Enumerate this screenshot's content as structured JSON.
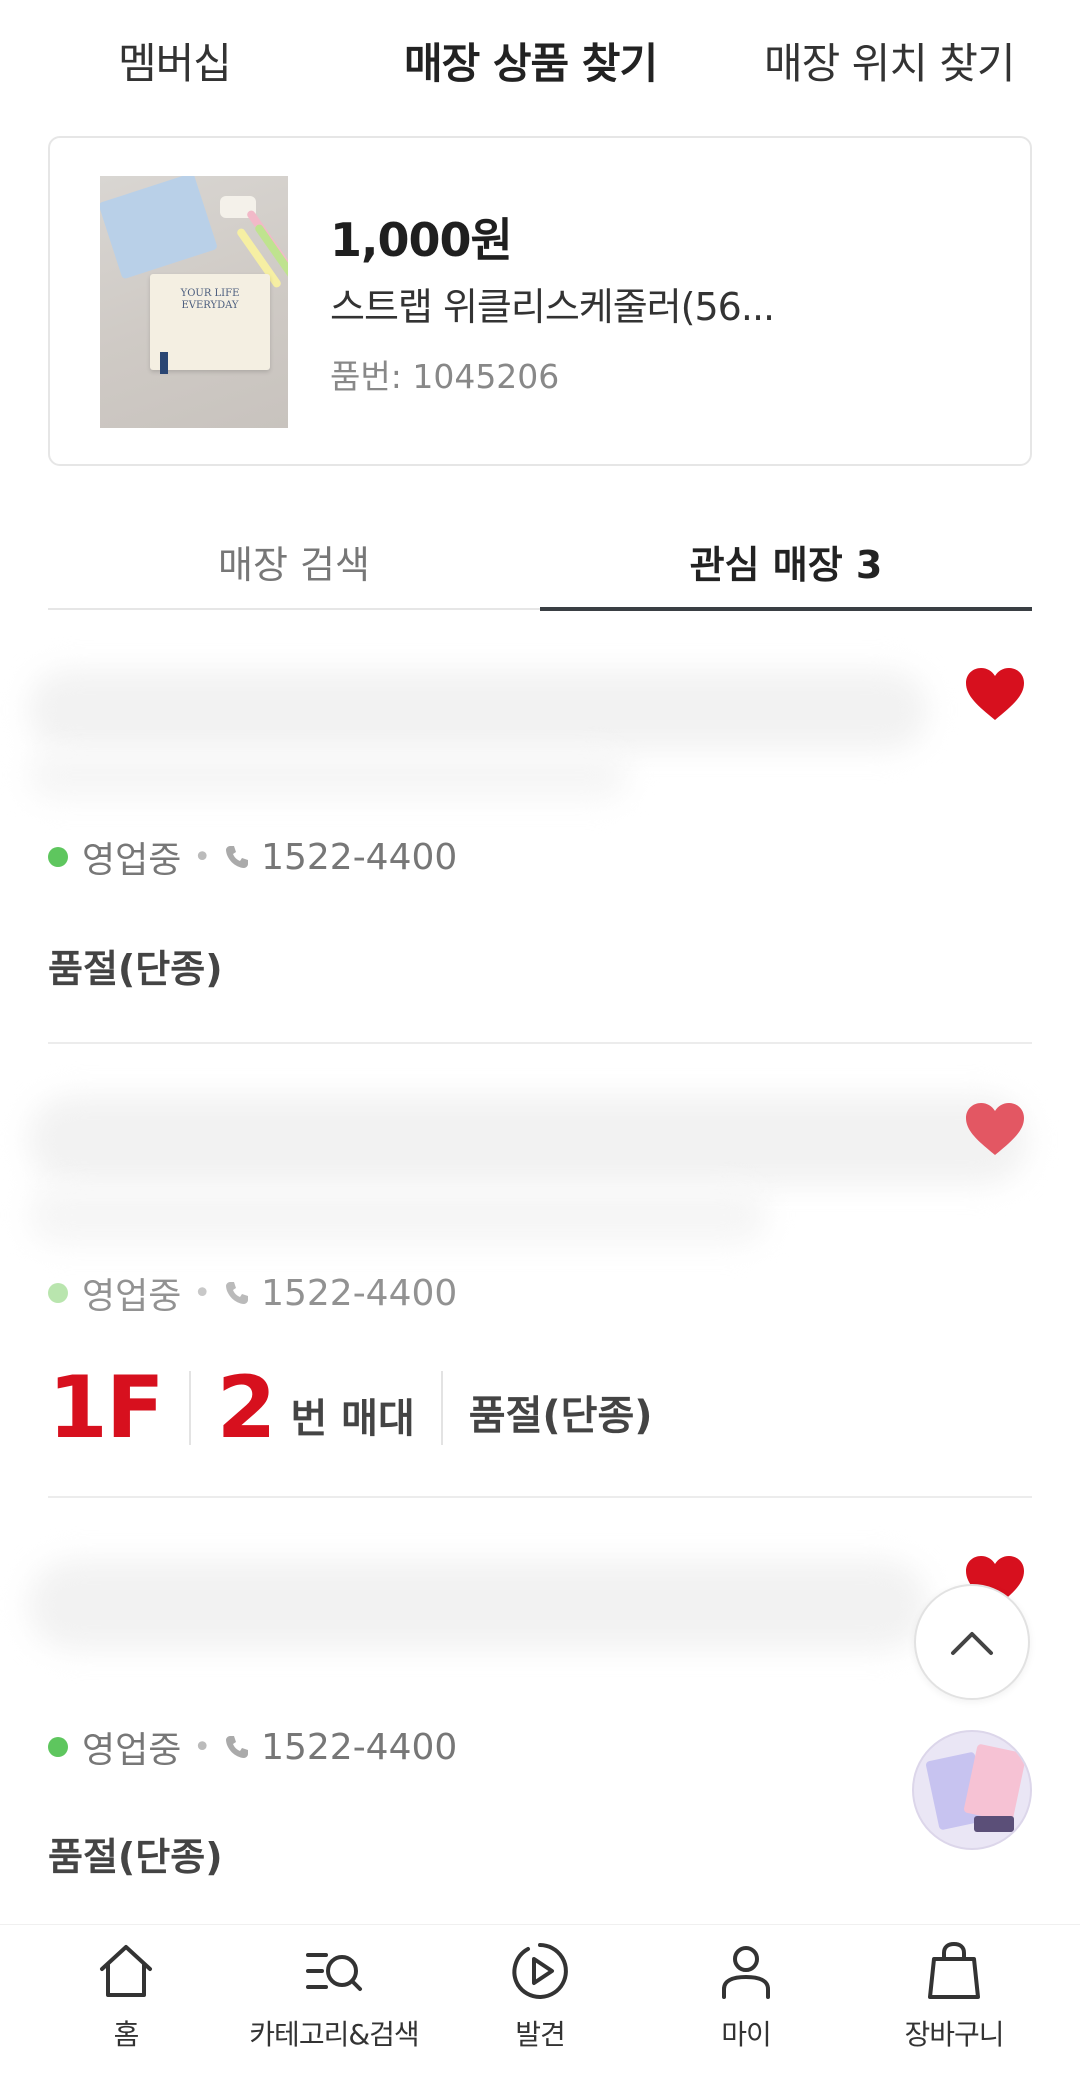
{
  "top_tabs": [
    {
      "label": "멤버십",
      "active": false
    },
    {
      "label": "매장 상품 찾기",
      "active": true
    },
    {
      "label": "매장 위치 찾기",
      "active": false
    }
  ],
  "product": {
    "price": "1,000원",
    "name": "스트랩 위클리스케줄러(56...",
    "code": "품번: 1045206",
    "thumb_text": "YOUR LIFE EVERYDAY"
  },
  "sub_tabs": {
    "search": "매장 검색",
    "favorites": "관심 매장 3"
  },
  "stores": [
    {
      "status": "영업중",
      "phone": "1522-4400",
      "stock": "품절(단종)",
      "favorited": true
    },
    {
      "status": "영업중",
      "phone": "1522-4400",
      "floor": "1F",
      "stand_number": "2",
      "stand_label": "번 매대",
      "stock": "품절(단종)",
      "favorited": true
    },
    {
      "status": "영업중",
      "phone": "1522-4400",
      "stock": "품절(단종)",
      "favorited": true
    }
  ],
  "separator": "•",
  "bottom_nav": [
    {
      "label": "홈",
      "icon": "home-icon"
    },
    {
      "label": "카테고리&검색",
      "icon": "category-search-icon"
    },
    {
      "label": "발견",
      "icon": "discover-play-icon"
    },
    {
      "label": "마이",
      "icon": "user-icon"
    },
    {
      "label": "장바구니",
      "icon": "shopping-bag-icon"
    }
  ],
  "colors": {
    "accent_red": "#d7101e",
    "heart_red": "#d7101e",
    "open_green": "#5ec65e",
    "tab_underline": "#3a3f44"
  }
}
